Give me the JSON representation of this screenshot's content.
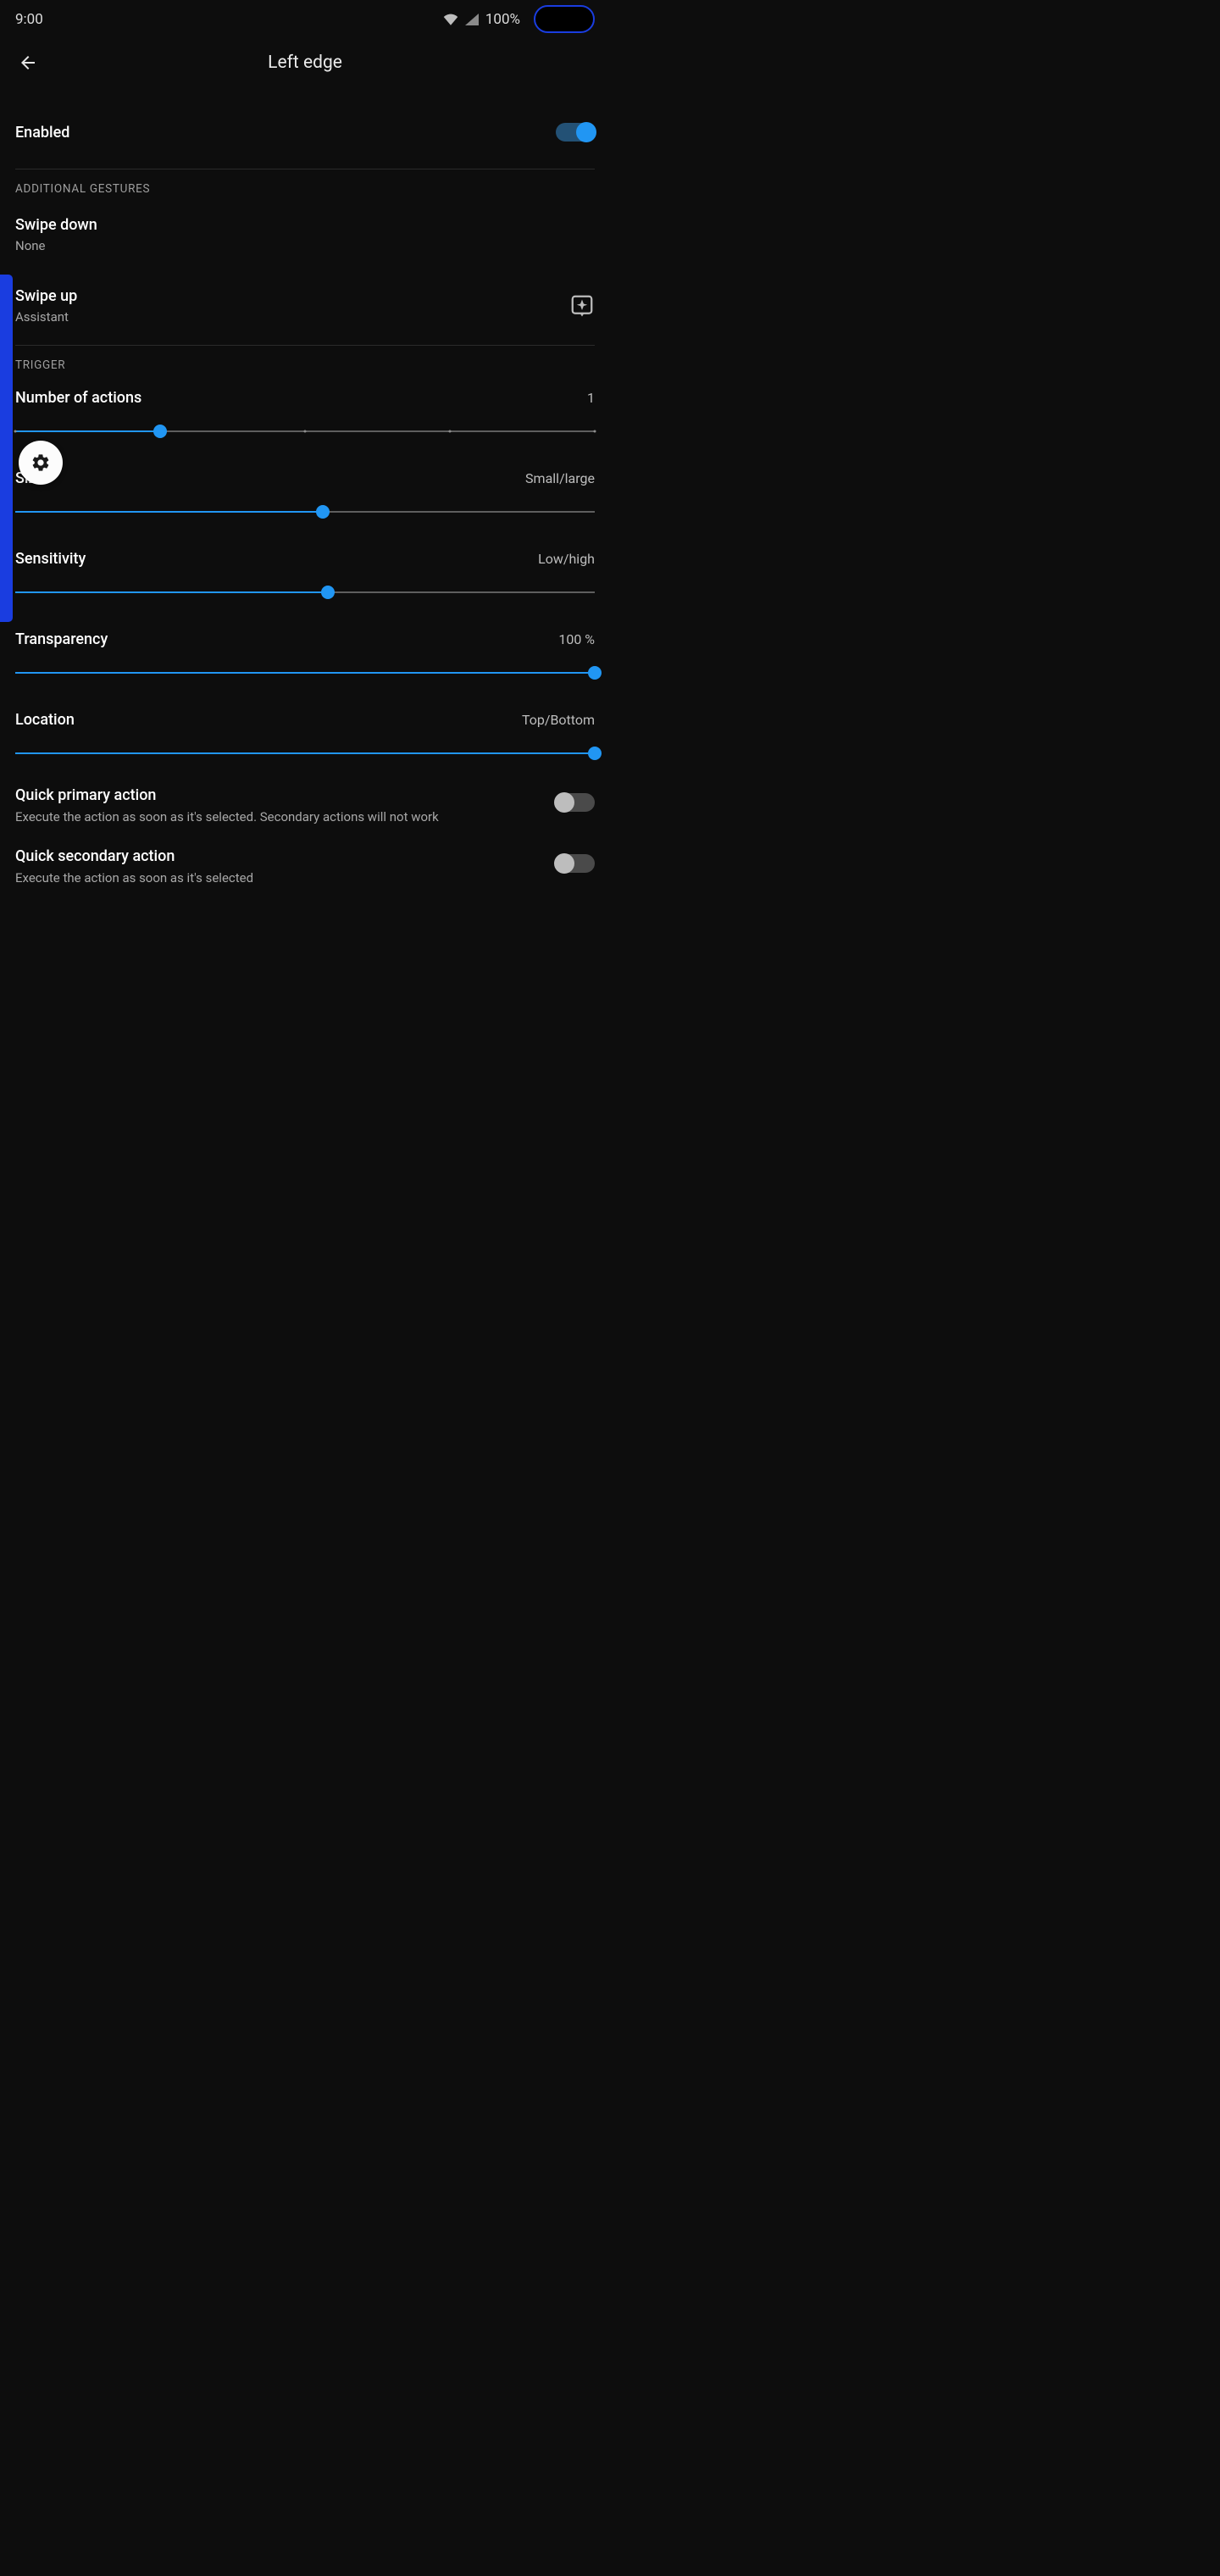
{
  "status": {
    "time": "9:00",
    "battery": "100%"
  },
  "header": {
    "title": "Left edge"
  },
  "enabled": {
    "label": "Enabled",
    "on": true
  },
  "sections": {
    "gestures": "ADDITIONAL GESTURES",
    "trigger": "TRIGGER"
  },
  "gestures": {
    "swipe_down": {
      "title": "Swipe down",
      "value": "None"
    },
    "swipe_up": {
      "title": "Swipe up",
      "value": "Assistant"
    }
  },
  "sliders": {
    "actions": {
      "title": "Number of actions",
      "value": "1",
      "percent": 25,
      "ticks": [
        0,
        25,
        50,
        75,
        100
      ]
    },
    "size": {
      "title": "Size",
      "value": "Small/large",
      "percent": 53
    },
    "sensitivity": {
      "title": "Sensitivity",
      "value": "Low/high",
      "percent": 54
    },
    "transparency": {
      "title": "Transparency",
      "value": "100 %",
      "percent": 100
    },
    "location": {
      "title": "Location",
      "value": "Top/Bottom",
      "percent": 100
    }
  },
  "toggles": {
    "quick_primary": {
      "title": "Quick primary action",
      "desc": "Execute the action as soon as it's selected. Secondary actions will not work",
      "on": false
    },
    "quick_secondary": {
      "title": "Quick secondary action",
      "desc": "Execute the action as soon as it's selected",
      "on": false
    }
  }
}
